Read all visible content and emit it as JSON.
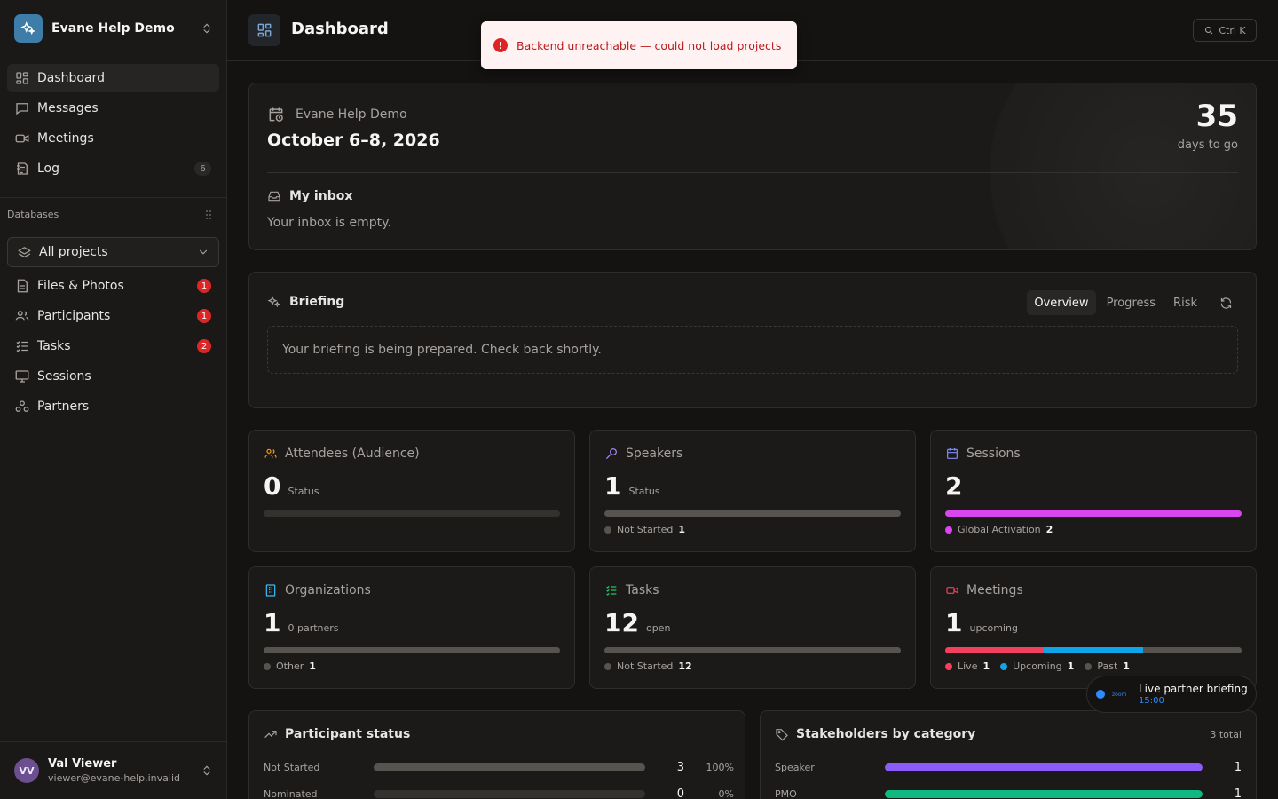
{
  "workspace": {
    "name": "Evane Help Demo"
  },
  "nav": [
    {
      "label": "Dashboard",
      "icon": "dashboard-icon",
      "active": true
    },
    {
      "label": "Messages",
      "icon": "message-icon"
    },
    {
      "label": "Meetings",
      "icon": "video-icon"
    },
    {
      "label": "Log",
      "icon": "log-icon",
      "count": "6"
    }
  ],
  "databases": {
    "heading": "Databases",
    "project_select": "All projects",
    "items": [
      {
        "label": "Files & Photos",
        "icon": "file-icon",
        "badge": "1"
      },
      {
        "label": "Participants",
        "icon": "users-icon",
        "badge": "1"
      },
      {
        "label": "Tasks",
        "icon": "checklist-icon",
        "badge": "2"
      },
      {
        "label": "Sessions",
        "icon": "presentation-icon"
      },
      {
        "label": "Partners",
        "icon": "partners-icon"
      }
    ]
  },
  "user": {
    "initials": "VV",
    "name": "Val Viewer",
    "email": "viewer@evane-help.invalid"
  },
  "header": {
    "title": "Dashboard",
    "search_shortcut": "Ctrl K"
  },
  "toast": {
    "message": "Backend unreachable — could not load projects"
  },
  "event": {
    "name": "Evane Help Demo",
    "dates": "October 6–8, 2026",
    "countdown": "35",
    "countdown_label": "days to go",
    "inbox_title": "My inbox",
    "inbox_empty": "Your inbox is empty."
  },
  "briefing": {
    "title": "Briefing",
    "tabs": [
      "Overview",
      "Progress",
      "Risk"
    ],
    "active_tab": "Overview",
    "message": "Your briefing is being prepared. Check back shortly."
  },
  "stats": [
    {
      "title": "Attendees (Audience)",
      "icon": "audience-icon",
      "color": "#f59e0b",
      "value": "0",
      "sub": "Status",
      "segments": [],
      "legend": []
    },
    {
      "title": "Speakers",
      "icon": "mic-icon",
      "color": "#a78bfa",
      "value": "1",
      "sub": "Status",
      "segments": [
        {
          "color": "#57534e",
          "fraction": 1
        }
      ],
      "legend": [
        {
          "label": "Not Started",
          "value": "1",
          "color": "#57534e"
        }
      ]
    },
    {
      "title": "Sessions",
      "icon": "calendar-icon",
      "color": "#818cf8",
      "value": "2",
      "sub": "",
      "segments": [
        {
          "color": "#d946ef",
          "fraction": 1
        }
      ],
      "legend": [
        {
          "label": "Global Activation",
          "value": "2",
          "color": "#d946ef"
        }
      ]
    },
    {
      "title": "Organizations",
      "icon": "building-icon",
      "color": "#38bdf8",
      "value": "1",
      "sub": "0 partners",
      "segments": [
        {
          "color": "#57534e",
          "fraction": 1
        }
      ],
      "legend": [
        {
          "label": "Other",
          "value": "1",
          "color": "#57534e"
        }
      ]
    },
    {
      "title": "Tasks",
      "icon": "task-list-icon",
      "color": "#22c55e",
      "value": "12",
      "sub": "open",
      "segments": [
        {
          "color": "#57534e",
          "fraction": 1
        }
      ],
      "legend": [
        {
          "label": "Not Started",
          "value": "12",
          "color": "#57534e"
        }
      ]
    },
    {
      "title": "Meetings",
      "icon": "video-camera-icon",
      "color": "#f43f5e",
      "value": "1",
      "sub": "upcoming",
      "segments": [
        {
          "color": "#f43f5e",
          "fraction": 0.3333
        },
        {
          "color": "#0ea5e9",
          "fraction": 0.3333
        },
        {
          "color": "#57534e",
          "fraction": 0.3334
        }
      ],
      "legend": [
        {
          "label": "Live",
          "value": "1",
          "color": "#f43f5e"
        },
        {
          "label": "Upcoming",
          "value": "1",
          "color": "#0ea5e9"
        },
        {
          "label": "Past",
          "value": "1",
          "color": "#57534e"
        }
      ]
    }
  ],
  "zoom_meeting": {
    "provider": "zoom",
    "title": "Live partner briefing",
    "time": "15:00"
  },
  "participant_status": {
    "title": "Participant status",
    "rows": [
      {
        "label": "Not Started",
        "value": "3",
        "percent": "100%",
        "fraction": 1,
        "color": "#57534e"
      },
      {
        "label": "Nominated",
        "value": "0",
        "percent": "0%",
        "fraction": 0,
        "color": "#57534e"
      }
    ]
  },
  "stakeholders": {
    "title": "Stakeholders by category",
    "total": "3 total",
    "rows": [
      {
        "label": "Speaker",
        "value": "1",
        "fraction": 1,
        "color": "#8b5cf6"
      },
      {
        "label": "PMO",
        "value": "1",
        "fraction": 1,
        "color": "#10b981"
      }
    ]
  }
}
